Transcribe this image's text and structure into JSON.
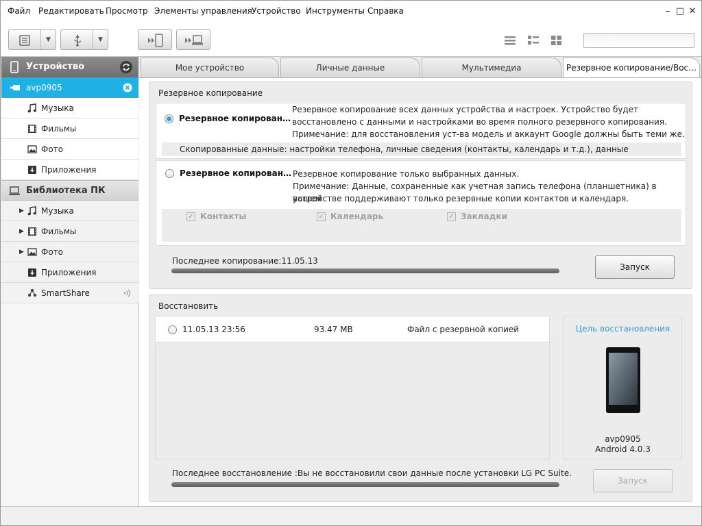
{
  "menubar": {
    "items": [
      "Файл",
      "Редактировать",
      "Просмотр",
      "Элементы управления",
      "Устройство",
      "Инструменты",
      "Справка"
    ],
    "window_controls": {
      "minimize": "–",
      "maximize": "□",
      "close": "✕"
    }
  },
  "search": {
    "value": "",
    "placeholder": ""
  },
  "sidebar": {
    "device_header": "Устройство",
    "device_name": "avp0905",
    "device_items": [
      "Музыка",
      "Фильмы",
      "Фото",
      "Приложения"
    ],
    "library_header": "Библиотека ПК",
    "library_items": [
      "Музыка",
      "Фильмы",
      "Фото",
      "Приложения",
      "SmartShare"
    ]
  },
  "main": {
    "tabs": [
      {
        "label": "Мое устройство"
      },
      {
        "label": "Личные данные"
      },
      {
        "label": "Мультимедиа"
      },
      {
        "label": "Резервное копирование/Вос…"
      }
    ]
  },
  "backup": {
    "title": "Резервное копирование",
    "full": {
      "label": "Резервное копирован…",
      "desc_1": "Резервное копирование всех данных устройства и настроек. Устройство будет",
      "desc_2": "восстановлено с данными и настройками во время полного резервного копирования.",
      "desc_3": "Примечание: для восстановления уст-ва модель и аккаунт Google должны быть теми же.",
      "copied": "Скопированные данные: настройки телефона, личные сведения (контакты, календарь и т.д.), данные приложения"
    },
    "selective": {
      "label": "Резервное копирован…",
      "desc_1": "Резервное копирование только выбранных данных.",
      "desc_2": "Примечание: Данные, сохраненные как учетная запись телефона (планшетника) в вашем",
      "desc_3": "устройстве поддерживают только резервные копии контактов и календаря.",
      "checkboxes": [
        "Контакты",
        "Календарь",
        "Закладки"
      ]
    },
    "last_backup": "Последнее копирование:11.05.13",
    "progress": 0,
    "start_button": "Запуск"
  },
  "restore": {
    "title": "Восстановить",
    "rows": [
      {
        "date": "11.05.13 23:56",
        "size": "93.47 MB",
        "type": "Файл с резервной копией"
      }
    ],
    "target_title": "Цель восстановления",
    "device_name": "avp0905",
    "device_os": "Android 4.0.3",
    "last_restore": "Последнее восстановление :Вы не восстановили свои данные после установки LG PC Suite.",
    "progress": 0,
    "start_button": "Запуск"
  },
  "colors": {
    "accent": "#1fb1e6",
    "link": "#2a9fd6"
  }
}
